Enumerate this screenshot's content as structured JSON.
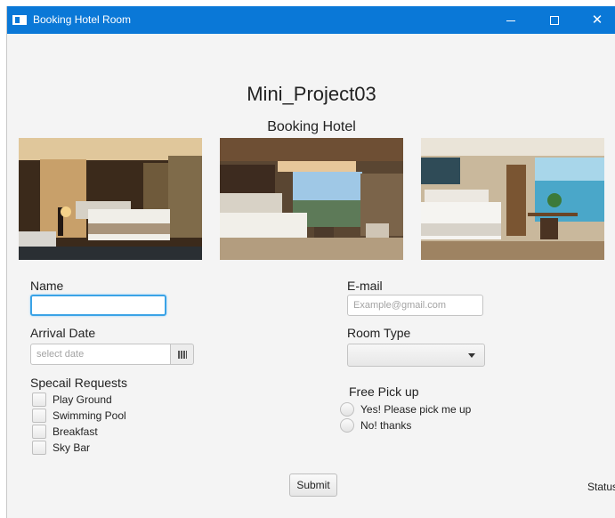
{
  "window": {
    "title": "Booking Hotel Room",
    "minimize": "",
    "maximize": "",
    "close": "✕"
  },
  "header": {
    "title": "Mini_Project03",
    "subtitle": "Booking Hotel"
  },
  "form": {
    "name_label": "Name",
    "name_value": "",
    "email_label": "E-mail",
    "email_placeholder": "Example@gmail.com",
    "arrival_label": "Arrival Date",
    "arrival_placeholder": "select date",
    "room_label": "Room Type",
    "room_value": "",
    "requests_label": "Specail Requests",
    "requests": [
      "Play Ground",
      "Swimming Pool",
      "Breakfast",
      "Sky Bar"
    ],
    "pickup_label": "Free Pick up",
    "pickup_options": [
      "Yes! Please pick me up",
      "No! thanks"
    ],
    "submit_label": "Submit",
    "status_label": "Status"
  },
  "icons": {
    "calendar": "calendar-icon",
    "dropdown": "chevron-down-icon"
  }
}
